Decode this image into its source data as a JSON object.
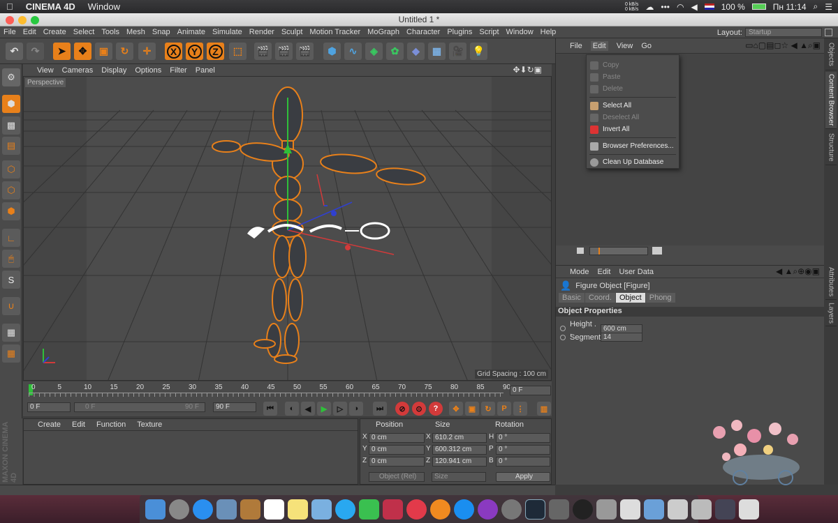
{
  "macbar": {
    "app": "CINEMA 4D",
    "window_menu": "Window",
    "battery": "100 %",
    "clock": "Пн 11:14",
    "net_up": "0 kB/s",
    "net_down": "0 kB/s"
  },
  "window": {
    "title": "Untitled 1 *"
  },
  "menu": [
    "File",
    "Edit",
    "Create",
    "Select",
    "Tools",
    "Mesh",
    "Snap",
    "Animate",
    "Simulate",
    "Render",
    "Sculpt",
    "Motion Tracker",
    "MoGraph",
    "Character",
    "Plugins",
    "Script",
    "Window",
    "Help"
  ],
  "layout": {
    "label": "Layout:",
    "value": "Startup"
  },
  "axis_buttons": [
    "X",
    "Y",
    "Z"
  ],
  "viewport": {
    "menu": [
      "View",
      "Cameras",
      "Display",
      "Options",
      "Filter",
      "Panel"
    ],
    "label": "Perspective",
    "grid_spacing": "Grid Spacing : 100 cm"
  },
  "timeline": {
    "ticks": [
      "0",
      "5",
      "10",
      "15",
      "20",
      "25",
      "30",
      "35",
      "40",
      "45",
      "50",
      "55",
      "60",
      "65",
      "70",
      "75",
      "80",
      "85",
      "90"
    ],
    "current_frame": "0 F"
  },
  "transport": {
    "start": "0 F",
    "range_start": "0 F",
    "range_end": "90 F",
    "end": "90 F"
  },
  "material": {
    "menu": [
      "Create",
      "Edit",
      "Function",
      "Texture"
    ]
  },
  "maxon": "MAXON CINEMA 4D",
  "coords": {
    "headers": [
      "Position",
      "Size",
      "Rotation"
    ],
    "rows": [
      {
        "axis": "X",
        "pos": "0 cm",
        "size_axis": "X",
        "size": "610.2 cm",
        "rot_axis": "H",
        "rot": "0 °"
      },
      {
        "axis": "Y",
        "pos": "0 cm",
        "size_axis": "Y",
        "size": "600.312 cm",
        "rot_axis": "P",
        "rot": "0 °"
      },
      {
        "axis": "Z",
        "pos": "0 cm",
        "size_axis": "Z",
        "size": "120.941 cm",
        "rot_axis": "B",
        "rot": "0 °"
      }
    ],
    "mode": "Object (Rel)",
    "size_mode": "Size",
    "apply": "Apply"
  },
  "content_browser": {
    "menu": [
      "File",
      "Edit",
      "View",
      "Go"
    ]
  },
  "edit_menu": {
    "items": [
      {
        "label": "Copy",
        "enabled": false
      },
      {
        "label": "Paste",
        "enabled": false
      },
      {
        "label": "Delete",
        "enabled": false
      },
      {
        "label": "Select All",
        "enabled": true
      },
      {
        "label": "Deselect All",
        "enabled": false
      },
      {
        "label": "Invert All",
        "enabled": true
      },
      {
        "label": "Browser Preferences...",
        "enabled": true
      },
      {
        "label": "Clean Up Database",
        "enabled": true
      }
    ]
  },
  "attributes": {
    "menu": [
      "Mode",
      "Edit",
      "User Data"
    ],
    "object": "Figure Object [Figure]",
    "tabs": [
      "Basic",
      "Coord.",
      "Object",
      "Phong"
    ],
    "active_tab": "Object",
    "section": "Object Properties",
    "fields": [
      {
        "label": "Height . .",
        "value": "600 cm"
      },
      {
        "label": "Segments",
        "value": "14"
      }
    ]
  },
  "side_tabs": [
    "Objects",
    "Content Browser",
    "Structure",
    "Attributes",
    "Layers"
  ],
  "colors": {
    "accent": "#e8801a",
    "panel": "#4a4a4a",
    "active_tab": "#5c6f8f"
  }
}
